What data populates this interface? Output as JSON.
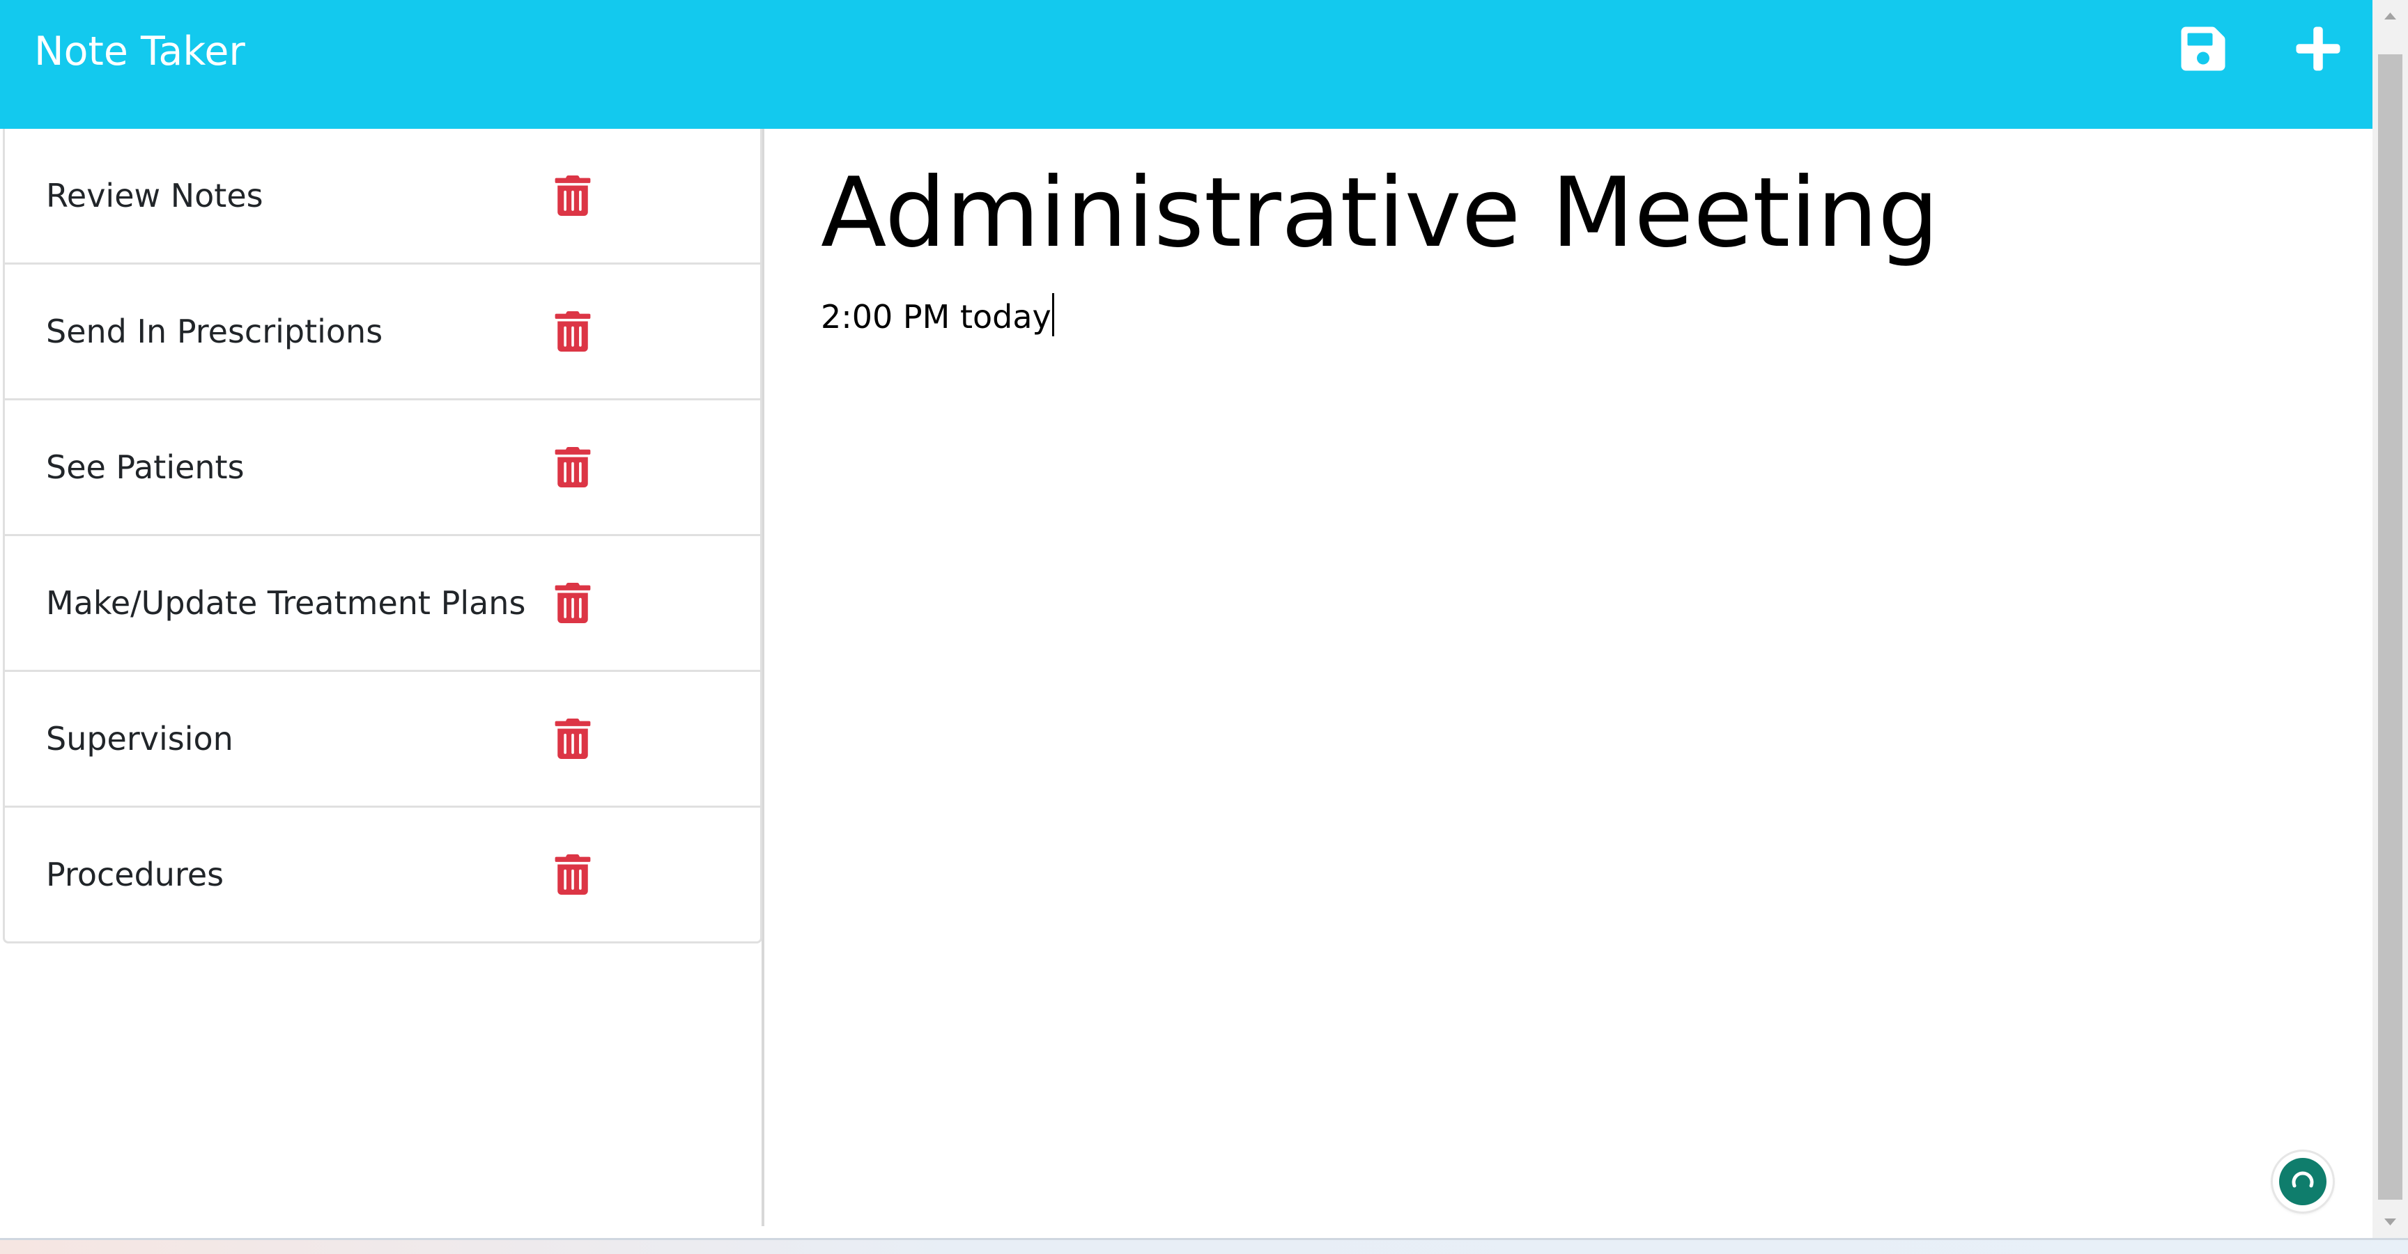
{
  "header": {
    "brand": "Note Taker",
    "save_icon": "floppy-disk-icon",
    "new_icon": "plus-icon",
    "background": "#13c9ee"
  },
  "notes": [
    {
      "title": "Review Notes",
      "delete_icon": "trash-icon"
    },
    {
      "title": "Send In Prescriptions",
      "delete_icon": "trash-icon"
    },
    {
      "title": "See Patients",
      "delete_icon": "trash-icon"
    },
    {
      "title": "Make/Update Treatment Plans",
      "delete_icon": "trash-icon"
    },
    {
      "title": "Supervision",
      "delete_icon": "trash-icon"
    },
    {
      "title": "Procedures",
      "delete_icon": "trash-icon"
    }
  ],
  "editor": {
    "title": "Administrative Meeting",
    "text": "2:00 PM today"
  },
  "colors": {
    "accent": "#13c9ee",
    "delete": "#dc3545",
    "fab": "#0f7d6c"
  }
}
